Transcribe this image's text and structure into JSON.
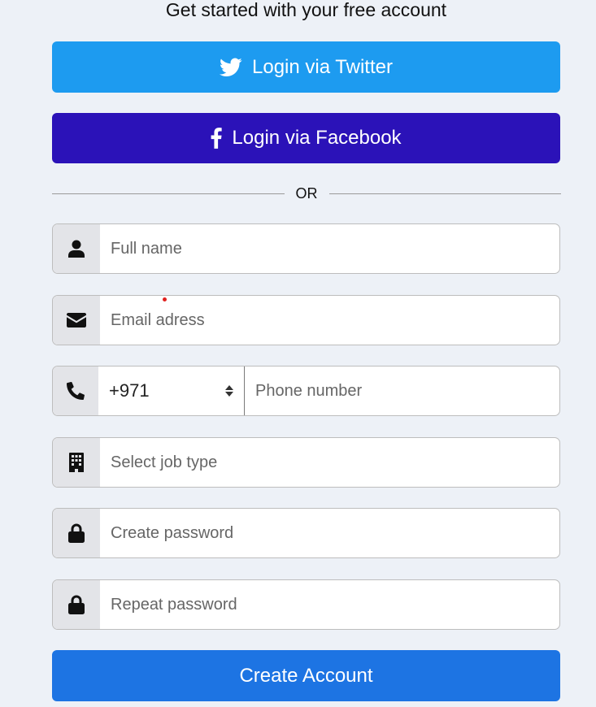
{
  "heading": "Get started with your free account",
  "social": {
    "twitter_label": "Login via Twitter",
    "facebook_label": "Login via Facebook"
  },
  "divider_text": "OR",
  "fields": {
    "full_name_placeholder": "Full name",
    "email_placeholder": "Email adress",
    "phone_code_value": "+971",
    "phone_placeholder": "Phone number",
    "job_type_placeholder": "Select job type",
    "password_placeholder": "Create password",
    "repeat_password_placeholder": "Repeat password"
  },
  "submit_label": "Create Account",
  "colors": {
    "twitter": "#1d9bf0",
    "facebook": "#2b12b8",
    "create": "#1d74e3",
    "page_bg": "#edf1f7"
  },
  "icons": [
    "twitter-icon",
    "facebook-icon",
    "user-icon",
    "envelope-icon",
    "phone-icon",
    "building-icon",
    "lock-icon"
  ]
}
